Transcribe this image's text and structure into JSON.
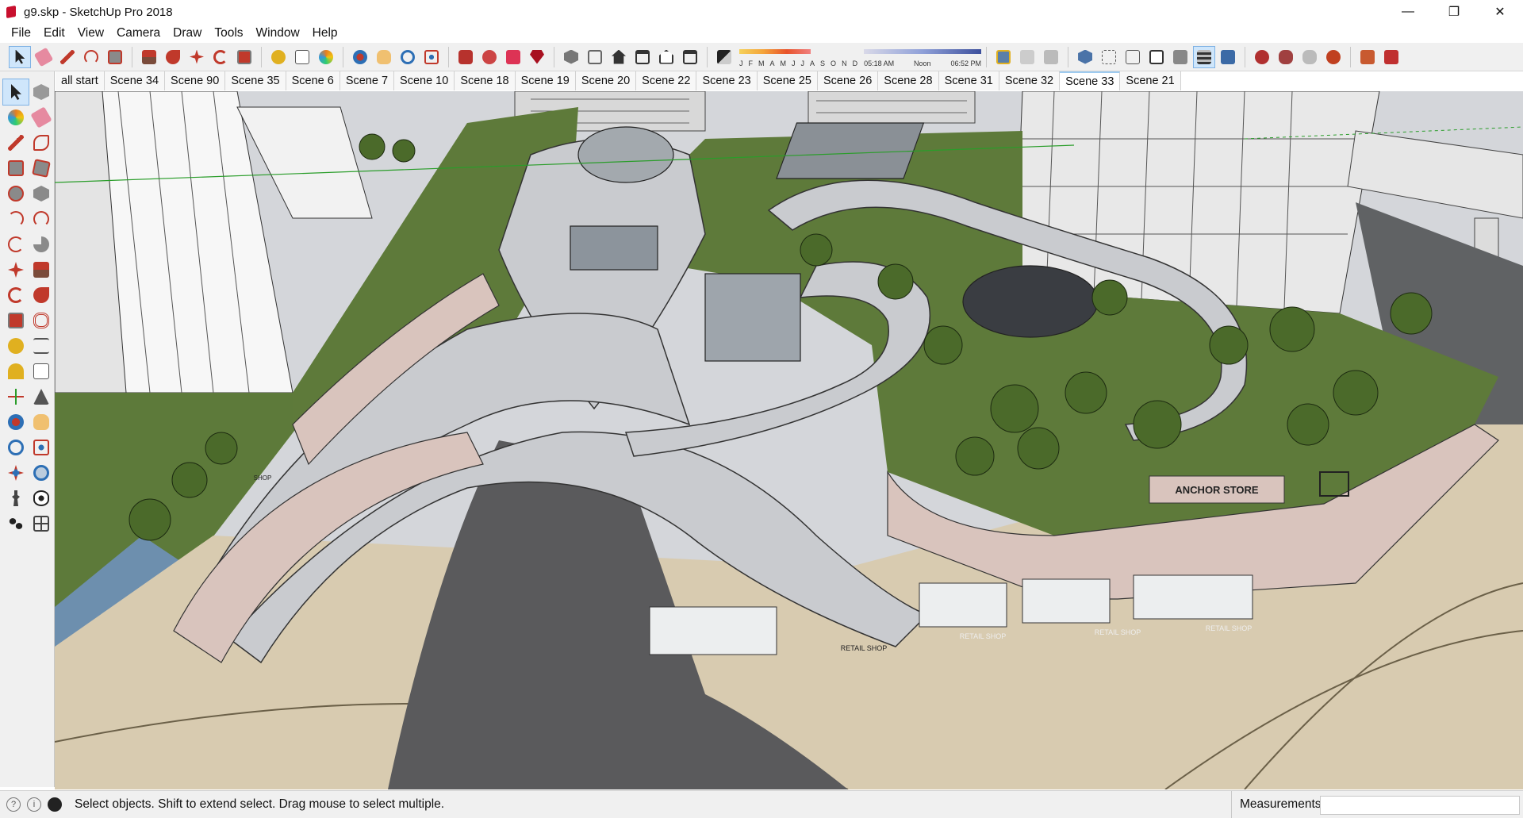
{
  "window": {
    "title": "g9.skp - SketchUp Pro 2018",
    "controls": {
      "minimize": "—",
      "restore": "❐",
      "close": "✕"
    }
  },
  "menu": [
    "File",
    "Edit",
    "View",
    "Camera",
    "Draw",
    "Tools",
    "Window",
    "Help"
  ],
  "toolbar": {
    "shadow_months": [
      "J",
      "F",
      "M",
      "A",
      "M",
      "J",
      "J",
      "A",
      "S",
      "O",
      "N",
      "D"
    ],
    "time_labels": {
      "start": "05:18 AM",
      "mid": "Noon",
      "end": "06:52 PM"
    }
  },
  "scenes": {
    "active_index": 18,
    "tabs": [
      "all start",
      "Scene 34",
      "Scene 90",
      "Scene 35",
      "Scene 6",
      "Scene 7",
      "Scene 10",
      "Scene 18",
      "Scene 19",
      "Scene 20",
      "Scene 22",
      "Scene 23",
      "Scene 25",
      "Scene 26",
      "Scene 28",
      "Scene 31",
      "Scene 32",
      "Scene 33",
      "Scene 21"
    ]
  },
  "model_signage": {
    "anchor_store": "ANCHOR STORE",
    "retail_shop": "RETAIL SHOP",
    "shop": "SHOP"
  },
  "status": {
    "message": "Select objects. Shift to extend select. Drag mouse to select multiple.",
    "measurements_label": "Measurements",
    "measurements_value": ""
  },
  "colors": {
    "accent_select": "#cfe6fb",
    "roof_green": "#5e7a3a",
    "facade_pink": "#d9c4bd",
    "walkway_grey": "#c9cbcf",
    "road_dark": "#5a5a5c",
    "plaza_tan": "#d8cbb0"
  }
}
